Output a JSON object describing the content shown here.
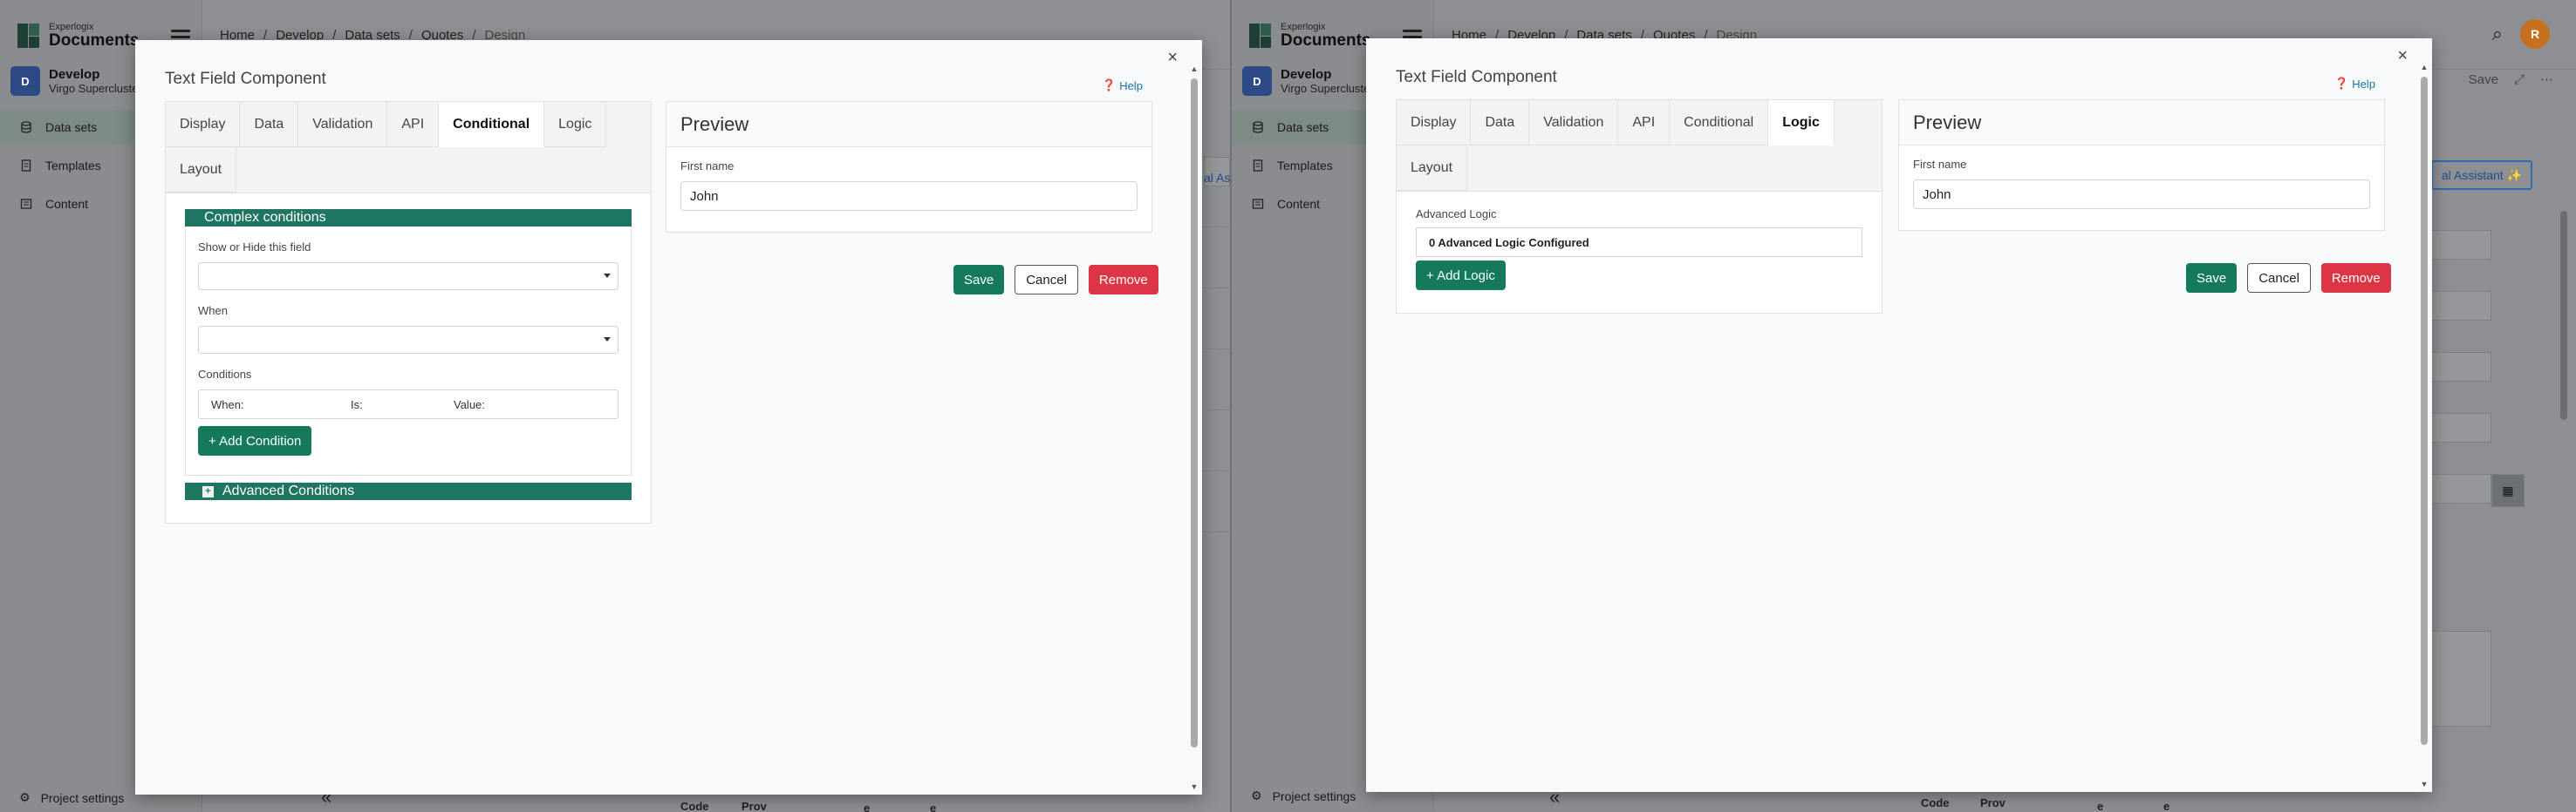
{
  "background": {
    "brand_small": "Experlogix",
    "brand_big": "Documents",
    "workspace_badge": "D",
    "workspace_name": "Develop",
    "workspace_sub": "Virgo Supercluster",
    "nav": [
      "Data sets",
      "Templates",
      "Content"
    ],
    "project_settings": "Project settings",
    "breadcrumb": [
      "Home",
      "Develop",
      "Data sets",
      "Quotes",
      "Design"
    ],
    "avatar_initial": "R",
    "ai_assistant": "al Assistant ✨",
    "partial_asst": "al Ass",
    "save_ghost": "Save",
    "footer_bits": [
      "Code",
      "Prov",
      "e",
      "e"
    ],
    "collapse": "«"
  },
  "modal_conditional": {
    "title": "Text Field Component",
    "help": "Help",
    "close": "×",
    "tabs": [
      "Display",
      "Data",
      "Validation",
      "API",
      "Conditional",
      "Logic",
      "Layout"
    ],
    "active_tab": "Conditional",
    "complex_conditions": "Complex conditions",
    "show_hide_label": "Show or Hide this field",
    "when_label": "When",
    "conditions_label": "Conditions",
    "cond_when": "When:",
    "cond_is": "Is:",
    "cond_value": "Value:",
    "add_condition": "+ Add Condition",
    "advanced_conditions": "Advanced Conditions",
    "advanced_toggle": "+"
  },
  "modal_logic": {
    "title": "Text Field Component",
    "help": "Help",
    "close": "×",
    "tabs": [
      "Display",
      "Data",
      "Validation",
      "API",
      "Conditional",
      "Logic",
      "Layout"
    ],
    "active_tab": "Logic",
    "advanced_logic_label": "Advanced Logic",
    "advanced_logic_value": "0 Advanced Logic Configured",
    "add_logic": "+ Add Logic"
  },
  "preview": {
    "title": "Preview",
    "field_label": "First name",
    "field_value": "John"
  },
  "actions": {
    "save": "Save",
    "cancel": "Cancel",
    "remove": "Remove"
  },
  "colors": {
    "primary_green": "#157a5c",
    "panel_green": "#1e7561",
    "danger_red": "#dc3545",
    "link_blue": "#1a73a8",
    "avatar_orange": "#c6701f",
    "workspace_blue": "#2c4a86"
  },
  "icons": {
    "help": "help-circle-icon",
    "close": "close-icon",
    "data_sets": "database-icon",
    "templates": "document-icon",
    "content": "folder-icon",
    "settings": "gear-icon",
    "search": "search-icon",
    "menu": "hamburger-icon",
    "expand": "expand-icon",
    "more": "more-icon",
    "calendar": "calendar-icon"
  }
}
